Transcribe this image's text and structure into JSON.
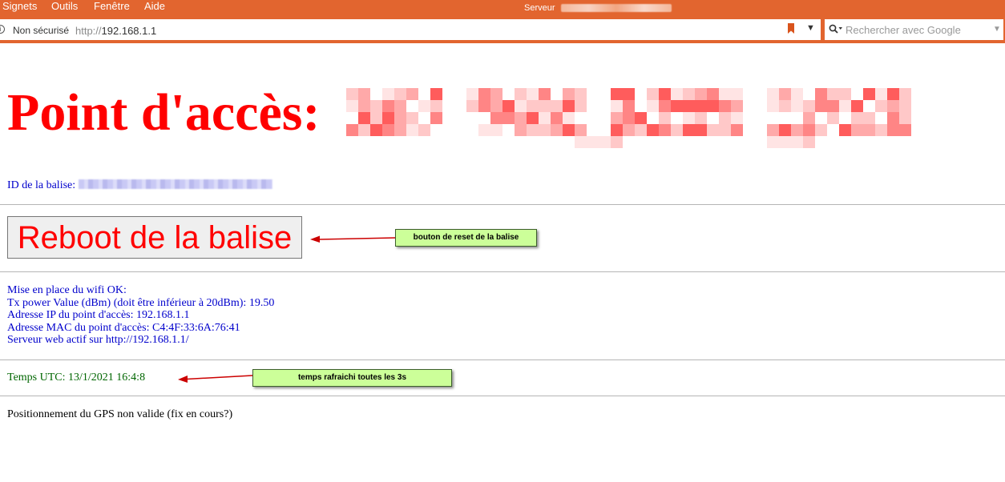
{
  "browser": {
    "menu": [
      "Signets",
      "Outils",
      "Fenêtre",
      "Aide"
    ],
    "window_title_prefix": "Serveur",
    "security_label": "Non sécurisé",
    "url_protocol": "http://",
    "url_host": "192.168.1.1",
    "search_placeholder": "Rechercher avec Google",
    "accent_color": "#e2652f"
  },
  "page": {
    "heading": "Point d'accès:",
    "id_label": "ID de la balise:",
    "reboot_button": "Reboot de la balise",
    "wifi_lines": [
      "Mise en place du wifi OK:",
      "Tx power Value (dBm) (doit être inférieur à 20dBm): 19.50",
      "Adresse IP du point d'accès: 192.168.1.1",
      "Adresse MAC du point d'accès: C4:4F:33:6A:76:41",
      "Serveur web actif sur http://192.168.1.1/"
    ],
    "utc_time": "Temps UTC: 13/1/2021 16:4:8",
    "gps_status": "Positionnement du GPS non valide (fix en cours?)"
  },
  "annotations": {
    "reset_note": "bouton de reset de la balise",
    "refresh_note": "temps rafraichi toutes les 3s"
  }
}
